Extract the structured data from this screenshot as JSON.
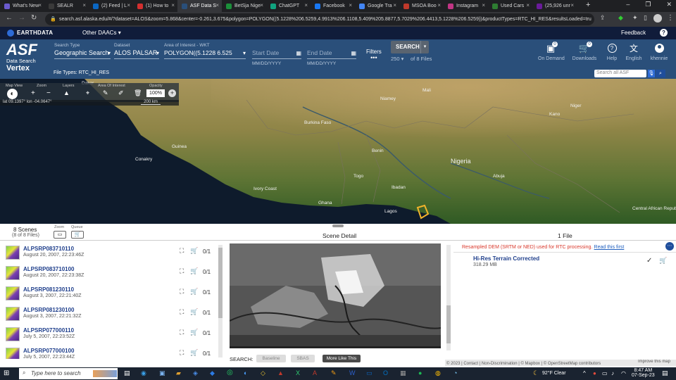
{
  "browser": {
    "tabs": [
      {
        "label": "What's New",
        "color": "#6a5acd"
      },
      {
        "label": "SEALR",
        "color": "#3a3a3a"
      },
      {
        "label": "(2) Feed | L",
        "color": "#0a66c2"
      },
      {
        "label": "(1) How to",
        "color": "#d32f2f"
      },
      {
        "label": "ASF Data S",
        "color": "#2a4f7a"
      },
      {
        "label": "BetSja Nige",
        "color": "#1b8f3a"
      },
      {
        "label": "ChatGPT",
        "color": "#10a37f"
      },
      {
        "label": "Facebook",
        "color": "#1877f2"
      },
      {
        "label": "Google Tra",
        "color": "#4285f4"
      },
      {
        "label": "MSOA Boo",
        "color": "#c0392b"
      },
      {
        "label": "Instagram",
        "color": "#c13584"
      },
      {
        "label": "Used Cars",
        "color": "#2e7d32"
      },
      {
        "label": "(25,926 unr",
        "color": "#6a1b9a"
      }
    ],
    "url": "search.asf.alaska.edu/#/?dataset=ALOS&zoom=5.868&center=-0.261,3.675&polygon=POLYGON((5.1228%206.5259,4.9913%206.1108,5.409%205.8877,5.7029%206.4413,5.1228%206.5259))&productTypes=RTC_HI_RES&resultsLoaded=tru"
  },
  "earthdata": {
    "brand": "EARTHDATA",
    "other_daacs": "Other DAACs",
    "feedback": "Feedback"
  },
  "header": {
    "logo_line1": "ASF",
    "logo_line2": "Data Search",
    "logo_line3": "Vertex",
    "search_type_label": "Search Type",
    "search_type_value": "Geographic Search",
    "dataset_label": "Dataset",
    "dataset_value": "ALOS PALSAR",
    "aoi_label": "Area of Interest - WKT",
    "aoi_value": "POLYGON((5.1228 6.525",
    "start_date_placeholder": "Start Date",
    "start_date_format": "MM/DD/YYYY",
    "end_date_placeholder": "End Date",
    "end_date_format": "MM/DD/YYYY",
    "filters_label": "Filters",
    "search_button": "SEARCH",
    "max_results": "250",
    "of_files": "of 8 Files",
    "file_types": "File Types: RTC_HI_RES",
    "on_demand": "On Demand",
    "on_demand_badge": "0",
    "downloads": "Downloads",
    "downloads_badge": "0",
    "help": "Help",
    "language": "English",
    "user": "khennie",
    "search_all_placeholder": "Search all ASF"
  },
  "map_toolbar": {
    "map_view_label": "Map View",
    "zoom_label": "Zoom",
    "layers_label": "Layers",
    "aoi_label": "Area Of Interest",
    "opacity_label": "Opacity",
    "opacity_value": "100%",
    "coords": "lat 09.1397°  lon -04.0647°",
    "scale": "200 km"
  },
  "map_labels": [
    {
      "text": "Dakar"
    },
    {
      "text": "Mali"
    },
    {
      "text": "Niger"
    },
    {
      "text": "Burkina Faso"
    },
    {
      "text": "Guinea"
    },
    {
      "text": "Conakry"
    },
    {
      "text": "Benin"
    },
    {
      "text": "Togo"
    },
    {
      "text": "Nigeria"
    },
    {
      "text": "Ivory Coast"
    },
    {
      "text": "Ghana"
    },
    {
      "text": "Lagos"
    },
    {
      "text": "Ibadan"
    },
    {
      "text": "Abuja"
    },
    {
      "text": "Central African Republic"
    },
    {
      "text": "Kano"
    },
    {
      "text": "Niamey"
    }
  ],
  "results": {
    "scenes_count": "8 Scenes",
    "files_count": "(8 of 8 Files)",
    "zoom_label": "Zoom",
    "queue_label": "Queue",
    "scene_detail_title": "Scene Detail",
    "files_title": "1 File",
    "scenes": [
      {
        "name": "ALPSRP083710110",
        "date": "August 20, 2007, 22:23:46Z",
        "count": "0/1"
      },
      {
        "name": "ALPSRP083710100",
        "date": "August 20, 2007, 22:23:38Z",
        "count": "0/1"
      },
      {
        "name": "ALPSRP081230110",
        "date": "August 3, 2007, 22:21:40Z",
        "count": "0/1"
      },
      {
        "name": "ALPSRP081230100",
        "date": "August 3, 2007, 22:21:32Z",
        "count": "0/1"
      },
      {
        "name": "ALPSRP077000110",
        "date": "July 5, 2007, 22:23:52Z",
        "count": "0/1"
      },
      {
        "name": "ALPSRP077000100",
        "date": "July 5, 2007, 22:23:44Z",
        "count": "0/1"
      }
    ],
    "search_label": "SEARCH:",
    "baseline_btn": "Baseline",
    "sbas_btn": "SBAS",
    "more_like_this_btn": "More Like This",
    "dem_notice": "Resampled DEM (SRTM or NED) used for RTC processing.",
    "read_first": "Read this first",
    "file_name": "Hi-Res Terrain Corrected",
    "file_size": "318.29 MB",
    "attribution": "© 2023 | Contact | Non-Discrimination | © Mapbox | © OpenStreetMap contributors",
    "improve_map": "Improve this map"
  },
  "taskbar": {
    "search_placeholder": "Type here to search",
    "weather": "92°F  Clear",
    "time": "8:47 AM",
    "date": "07-Sep-23"
  }
}
